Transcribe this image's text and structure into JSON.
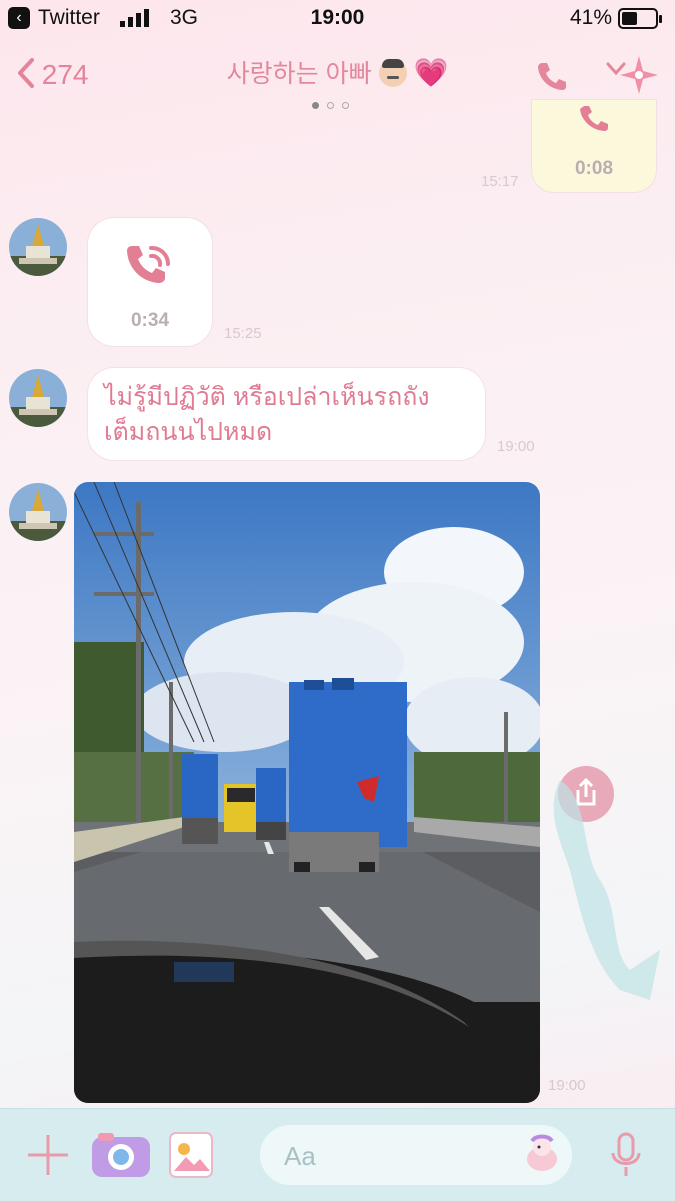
{
  "status_bar": {
    "carrier": "Twitter",
    "network": "3G",
    "time": "19:00",
    "battery": "41%"
  },
  "header": {
    "back_count": "274",
    "title": "사랑하는 아빠"
  },
  "messages": [
    {
      "type": "call",
      "side": "right",
      "duration": "0:08",
      "time": "15:17"
    },
    {
      "type": "call",
      "side": "left",
      "duration": "0:34",
      "time": "15:25"
    },
    {
      "type": "text",
      "side": "left",
      "lines": [
        "ไม่รู้มีปฏิวัติ หรือเปล่าเห็นรถถัง",
        "เต็มถนนไปหมด"
      ],
      "time": "19:00"
    },
    {
      "type": "photo",
      "side": "left",
      "time": "19:00"
    }
  ],
  "input_bar": {
    "placeholder": "Aa"
  },
  "colors": {
    "accent": "#e3879d",
    "bar": "#d6ecef"
  }
}
